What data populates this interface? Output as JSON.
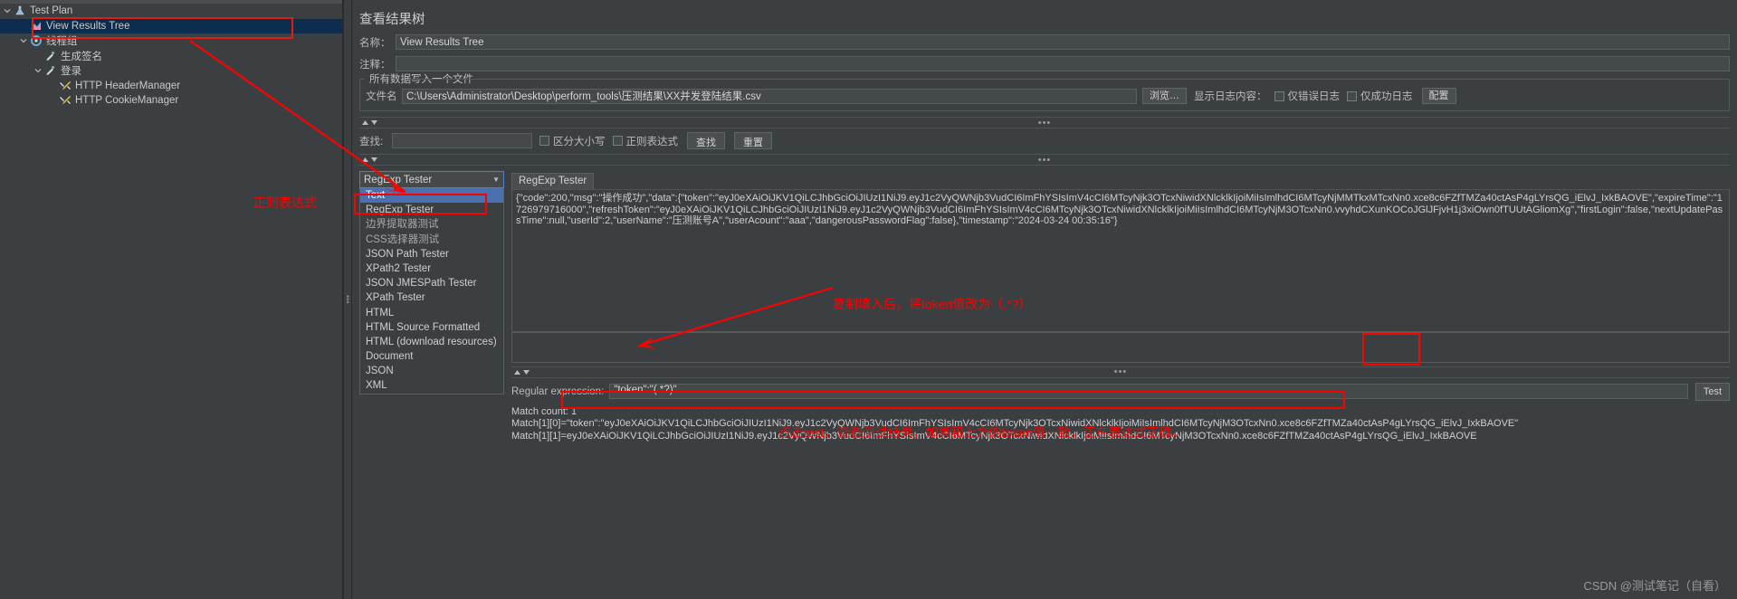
{
  "tree": {
    "items": [
      {
        "label": "Test Plan",
        "icon": "test-plan-icon",
        "indent": 0,
        "twisty": "down",
        "selected": false
      },
      {
        "label": "View Results Tree",
        "icon": "view-results-tree-icon",
        "indent": 1,
        "twisty": "none",
        "selected": true
      },
      {
        "label": "线程组",
        "icon": "thread-group-icon",
        "indent": 1,
        "twisty": "down",
        "selected": false
      },
      {
        "label": "生成签名",
        "icon": "sampler-icon",
        "indent": 2,
        "twisty": "none",
        "selected": false
      },
      {
        "label": "登录",
        "icon": "sampler-icon",
        "indent": 2,
        "twisty": "down",
        "selected": false
      },
      {
        "label": "HTTP HeaderManager",
        "icon": "config-element-icon",
        "indent": 3,
        "twisty": "none",
        "selected": false
      },
      {
        "label": "HTTP CookieManager",
        "icon": "config-element-icon",
        "indent": 3,
        "twisty": "none",
        "selected": false
      }
    ]
  },
  "panel": {
    "title": "查看结果树",
    "name_label": "名称：",
    "name_value": "View Results Tree",
    "comment_label": "注释：",
    "comment_value": "",
    "group_legend": "所有数据写入一个文件",
    "file_label": "文件名",
    "file_value": "C:\\Users\\Administrator\\Desktop\\perform_tools\\压测结果\\XX并发登陆结果.csv",
    "browse_label": "浏览…",
    "show_log_label": "显示日志内容：",
    "only_error_label": "仅错误日志",
    "only_success_label": "仅成功日志",
    "config_label": "配置"
  },
  "search": {
    "label": "查找:",
    "value": "",
    "case_sensitive_label": "区分大小写",
    "regex_label": "正则表达式",
    "find_button": "查找",
    "reset_button": "重置"
  },
  "selector": {
    "current": "RegExp Tester",
    "options": [
      {
        "label": "Text",
        "selected": true
      },
      {
        "label": "RegExp Tester",
        "selected": false
      },
      {
        "label": "边界提取器测试",
        "selected": false
      },
      {
        "label": "CSS选择器测试",
        "selected": false
      },
      {
        "label": "JSON Path Tester",
        "selected": false
      },
      {
        "label": "XPath2 Tester",
        "selected": false
      },
      {
        "label": "JSON JMESPath Tester",
        "selected": false
      },
      {
        "label": "XPath Tester",
        "selected": false
      },
      {
        "label": "HTML",
        "selected": false
      },
      {
        "label": "HTML Source Formatted",
        "selected": false
      },
      {
        "label": "HTML (download resources)",
        "selected": false
      },
      {
        "label": "Document",
        "selected": false
      },
      {
        "label": "JSON",
        "selected": false
      },
      {
        "label": "XML",
        "selected": false
      }
    ]
  },
  "tester": {
    "tab_label": "RegExp Tester",
    "response_text": "{\"code\":200,\"msg\":\"操作成功\",\"data\":{\"token\":\"eyJ0eXAiOiJKV1QiLCJhbGciOiJIUzI1NiJ9.eyJ1c2VyQWNjb3VudCI6ImFhYSIsImV4cCI6MTcyNjk3OTcxNiwidXNlcklkIjoiMiIsImlhdCI6MTcyNjMMTkxMTcxNn0.xce8c6FZfTMZa40ctAsP4gLYrsQG_iElvJ_IxkBAOVE\",\"expireTime\":\"1726979716000\",\"refreshToken\":\"eyJ0eXAiOiJKV1QiLCJhbGciOiJIUzI1NiJ9.eyJ1c2VyQWNjb3VudCI6ImFhYSIsImV4cCI6MTcyNjk3OTcxNiwidXNlcklkIjoiMiIsImlhdCI6MTcyNjM3OTcxNn0.vvyhdCXunKOCoJGlJFjvH1j3xiOwn0fTUUtAGliomXg\",\"firstLogin\":false,\"nextUpdatePassTime\":null,\"userId\":2,\"userName\":\"压测账号A\",\"userAcount\":\"aaa\",\"dangerousPasswordFlag\":false},\"timestamp\":\"2024-03-24 00:35:16\"}",
    "regex_label": "Regular expression:",
    "regex_value": "\"token\":\"(.*?)\"",
    "test_button": "Test",
    "match_count_label": "Match count: 1",
    "match_lines": [
      "Match[1][0]=\"token\":\"eyJ0eXAiOiJKV1QiLCJhbGciOiJIUzI1NiJ9.eyJ1c2VyQWNjb3VudCI6ImFhYSIsImV4cCI6MTcyNjk3OTcxNiwidXNlcklkIjoiMiIsImlhdCI6MTcyNjM3OTcxNn0.xce8c6FZfTMZa40ctAsP4gLYrsQG_iElvJ_IxkBAOVE\"",
      "Match[1][1]=eyJ0eXAiOiJKV1QiLCJhbGciOiJIUzI1NiJ9.eyJ1c2VyQWNjb3VudCI6ImFhYSIsImV4cCI6MTcyNjk3OTcxNiwidXNlcklkIjoiMiIsImlhdCI6MTcyNjM3OTcxNn0.xce8c6FZfTMZa40ctAsP4gLYrsQG_iElvJ_IxkBAOVE"
    ]
  },
  "annotations": {
    "regex_note": "正则表达式",
    "token_note": "复制填入后，将token值改为（.*?）",
    "test_note": "点击test，查看测试结果，如果和上方的token值一致，正在表达式正确。",
    "accent_color": "#ff0000"
  },
  "watermark": "CSDN @测试笔记（自看）"
}
